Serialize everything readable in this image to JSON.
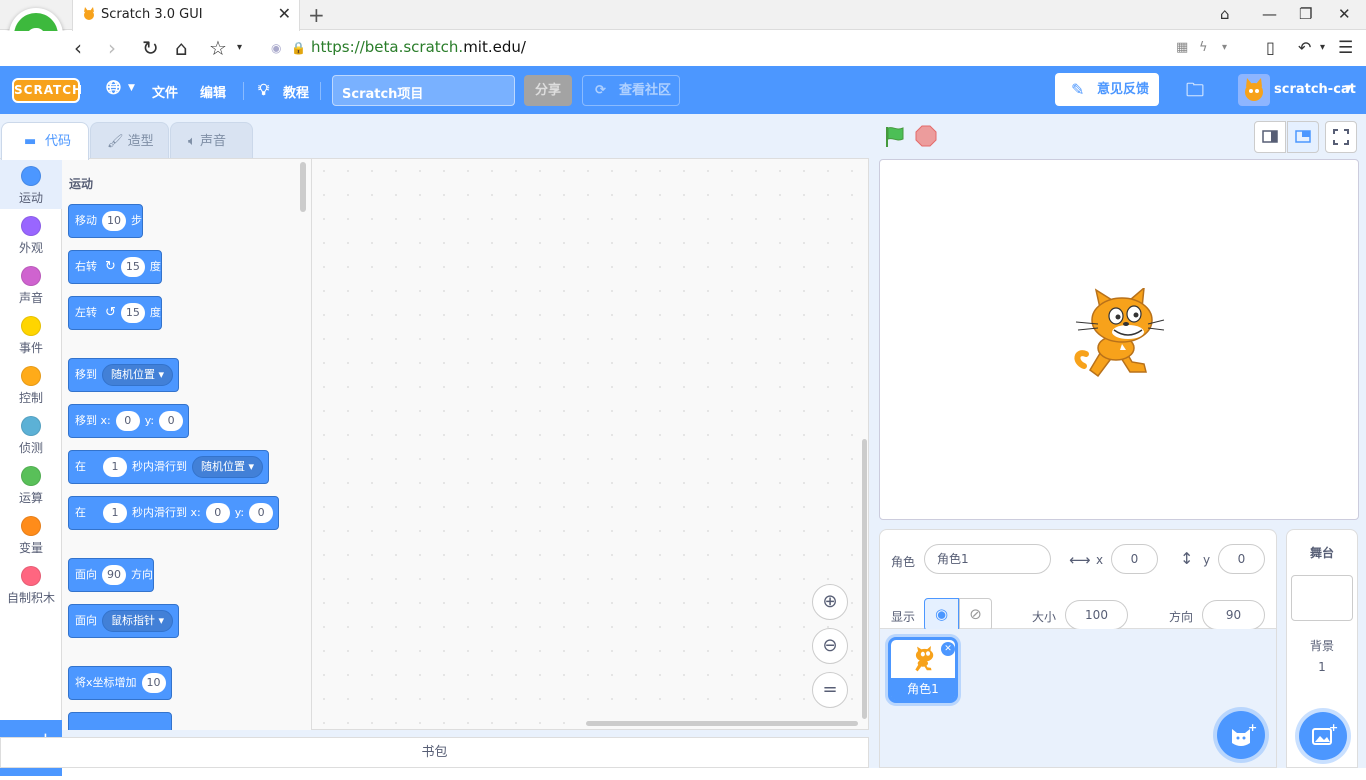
{
  "browser": {
    "tab_title": "Scratch 3.0 GUI",
    "url_scheme": "https://beta.scratch.",
    "url_host": "mit.edu",
    "url_path": "/"
  },
  "menubar": {
    "logo": "SCRATCH",
    "file": "文件",
    "edit": "编辑",
    "tutorials": "教程",
    "project_title": "Scratch项目",
    "share": "分享",
    "see_community": "查看社区",
    "feedback": "意见反馈",
    "username": "scratch-cat",
    "accent": "#4c97ff"
  },
  "editor_tabs": [
    "代码",
    "造型",
    "声音"
  ],
  "categories": [
    {
      "label": "运动",
      "color": "#4c97ff"
    },
    {
      "label": "外观",
      "color": "#9966ff"
    },
    {
      "label": "声音",
      "color": "#cf63cf"
    },
    {
      "label": "事件",
      "color": "#ffd500"
    },
    {
      "label": "控制",
      "color": "#ffab19"
    },
    {
      "label": "侦测",
      "color": "#5cb1d6"
    },
    {
      "label": "运算",
      "color": "#59c059"
    },
    {
      "label": "变量",
      "color": "#ff8c1a"
    },
    {
      "label": "自制积木",
      "color": "#ff6680"
    }
  ],
  "palette": {
    "heading": "运动",
    "blocks": {
      "move": {
        "a": "移动",
        "v": "10",
        "b": "步"
      },
      "turn_right": {
        "a": "右转",
        "v": "15",
        "b": "度"
      },
      "turn_left": {
        "a": "左转",
        "v": "15",
        "b": "度"
      },
      "goto": {
        "a": "移到",
        "d": "随机位置"
      },
      "goto_xy": {
        "a": "移到 x:",
        "x": "0",
        "y_label": "y:",
        "y": "0"
      },
      "glide": {
        "a": "在",
        "v": "1",
        "b": "秒内滑行到",
        "d": "随机位置"
      },
      "glide_xy": {
        "a": "在",
        "v": "1",
        "b": "秒内滑行到 x:",
        "x": "0",
        "y_label": "y:",
        "y": "0"
      },
      "point_dir": {
        "a": "面向",
        "v": "90",
        "b": "方向"
      },
      "point_towards": {
        "a": "面向",
        "d": "鼠标指针"
      },
      "change_x": {
        "a": "将x坐标增加",
        "v": "10"
      }
    }
  },
  "backpack": "书包",
  "sprite_info": {
    "sprite_label": "角色",
    "sprite_name": "角色1",
    "x_label": "x",
    "x": "0",
    "y_label": "y",
    "y": "0",
    "show_label": "显示",
    "size_label": "大小",
    "size": "100",
    "direction_label": "方向",
    "direction": "90"
  },
  "sprites": [
    {
      "name": "角色1"
    }
  ],
  "stage_pane": {
    "title": "舞台",
    "backdrops_label": "背景",
    "backdrops_count": "1"
  }
}
